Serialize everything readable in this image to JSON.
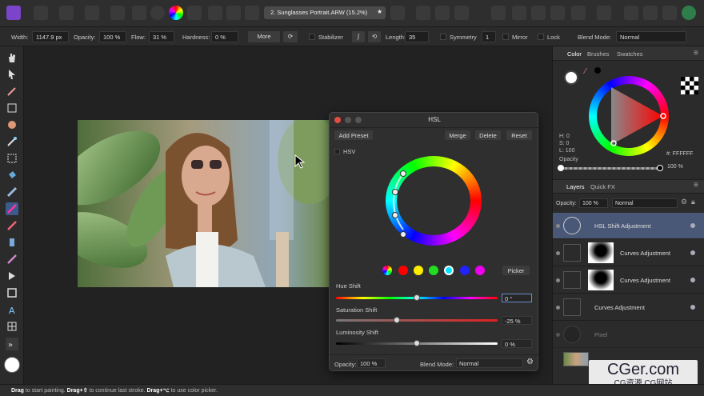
{
  "document_tab": "2. Sunglasses Portrait.ARW (15.2%)",
  "context_bar": {
    "width_label": "Width:",
    "width_value": "1147.9 px",
    "opacity_label": "Opacity:",
    "opacity_value": "100 %",
    "flow_label": "Flow:",
    "flow_value": "31 %",
    "hardness_label": "Hardness:",
    "hardness_value": "0 %",
    "more_label": "More",
    "stabilizer_label": "Stabilizer",
    "length_label": "Length:",
    "length_value": "35",
    "symmetry_label": "Symmetry",
    "symmetry_value": "1",
    "mirror_label": "Mirror",
    "lock_label": "Lock",
    "blend_label": "Blend Mode:",
    "blend_value": "Normal"
  },
  "hsl_dialog": {
    "title": "HSL",
    "add_preset": "Add Preset",
    "merge": "Merge",
    "delete": "Delete",
    "reset": "Reset",
    "hsv_label": "HSV",
    "picker": "Picker",
    "hue_label": "Hue Shift",
    "hue_value": "0 °",
    "hue_pos": 0.5,
    "sat_label": "Saturation Shift",
    "sat_value": "-25 %",
    "sat_pos": 0.375,
    "lum_label": "Luminosity Shift",
    "lum_value": "0 %",
    "lum_pos": 0.5,
    "opacity_label": "Opacity:",
    "opacity_value": "100 %",
    "blend_label": "Blend Mode:",
    "blend_value": "Normal",
    "swatches": [
      "#dddddd",
      "#ff0000",
      "#ffee00",
      "#22dd22",
      "#00e5ff",
      "#2222ff",
      "#ee00ee"
    ]
  },
  "color_panel": {
    "tabs": [
      "Color",
      "Brushes",
      "Swatches"
    ],
    "h": "H: 0",
    "s": "S: 0",
    "l": "L: 100",
    "hex": "#: FFFFFF",
    "opacity_label": "Opacity",
    "opacity_value": "100 %"
  },
  "layers_panel": {
    "tabs": [
      "Layers",
      "Quick FX"
    ],
    "opacity_label": "Opacity:",
    "opacity_value": "100 %",
    "blend_value": "Normal",
    "layers": [
      {
        "name": "HSL Shift Adjustment"
      },
      {
        "name": "Curves Adjustment"
      },
      {
        "name": "Curves Adjustment"
      },
      {
        "name": "Curves Adjustment"
      },
      {
        "name": "Pixel"
      }
    ]
  },
  "status": {
    "drag1": "Drag",
    "text1": " to start painting. ",
    "drag2": "Drag+⇧",
    "text2": " to continue last stroke. ",
    "drag3": "Drag+⌥",
    "text3": " to use color picker."
  },
  "watermark": {
    "main": "CGer.com",
    "sub": "CG资源 CG网站"
  }
}
